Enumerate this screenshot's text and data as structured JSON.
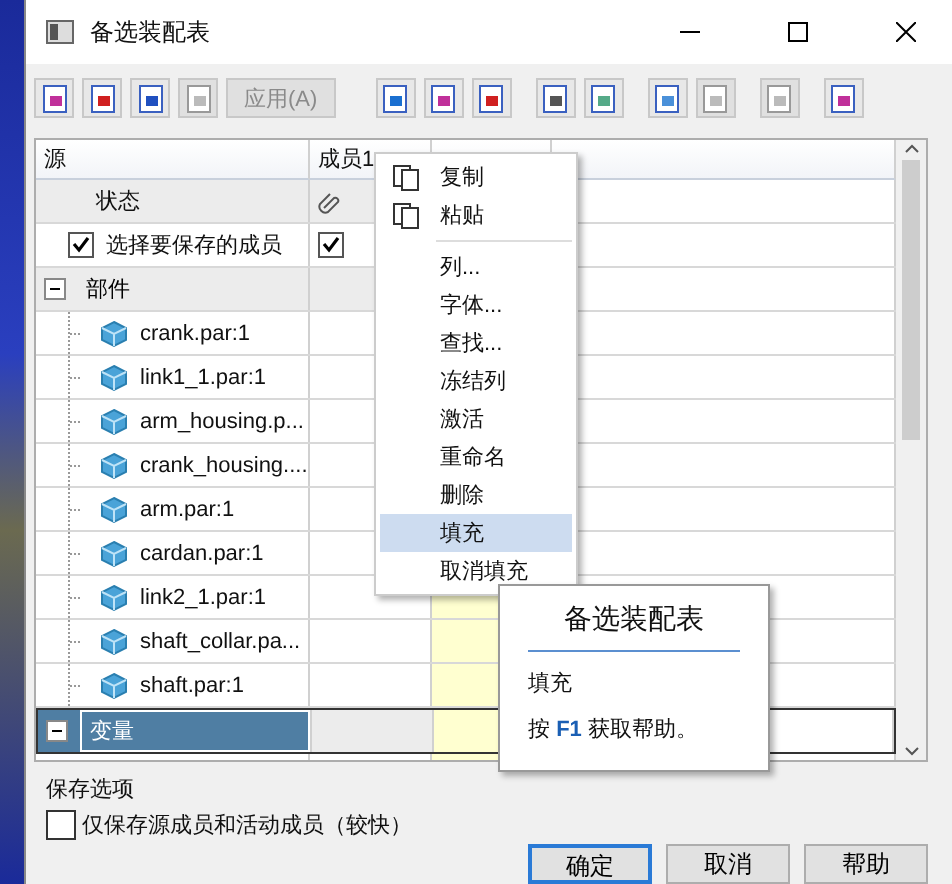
{
  "window": {
    "title": "备选装配表"
  },
  "toolbar": [
    {
      "kind": "icon",
      "disabled": false
    },
    {
      "kind": "icon",
      "disabled": false
    },
    {
      "kind": "icon",
      "disabled": false
    },
    {
      "kind": "icon",
      "disabled": true
    },
    {
      "kind": "text",
      "label": "应用(A)",
      "disabled": true
    },
    {
      "kind": "gap"
    },
    {
      "kind": "icon",
      "disabled": false
    },
    {
      "kind": "icon",
      "disabled": false
    },
    {
      "kind": "icon",
      "disabled": false
    },
    {
      "kind": "gap"
    },
    {
      "kind": "icon",
      "disabled": false
    },
    {
      "kind": "icon",
      "disabled": false
    },
    {
      "kind": "gap"
    },
    {
      "kind": "icon",
      "disabled": false
    },
    {
      "kind": "icon",
      "disabled": true
    },
    {
      "kind": "gap"
    },
    {
      "kind": "icon",
      "disabled": true
    },
    {
      "kind": "gap"
    },
    {
      "kind": "icon",
      "disabled": false
    }
  ],
  "table": {
    "columns": [
      {
        "label": "源"
      },
      {
        "label": "成员1"
      },
      {
        "filled": true
      }
    ],
    "rows": [
      {
        "kind": "status",
        "label": "状态"
      },
      {
        "kind": "check",
        "label": "选择要保存的成员",
        "checked": true,
        "member_checked": true
      },
      {
        "kind": "group",
        "label": "部件",
        "expanded": true,
        "selected": false,
        "children": [
          {
            "label": "crank.par:1"
          },
          {
            "label": "link1_1.par:1"
          },
          {
            "label": "arm_housing.p..."
          },
          {
            "label": "crank_housing...."
          },
          {
            "label": "arm.par:1"
          },
          {
            "label": "cardan.par:1"
          },
          {
            "label": "link2_1.par:1"
          },
          {
            "label": "shaft_collar.pa..."
          },
          {
            "label": "shaft.par:1"
          }
        ]
      },
      {
        "kind": "group",
        "label": "变量",
        "expanded": true,
        "selected": true
      }
    ]
  },
  "context_menu": [
    {
      "kind": "icon",
      "label": "复制",
      "selected": false
    },
    {
      "kind": "icon",
      "label": "粘贴",
      "selected": false
    },
    {
      "kind": "separator"
    },
    {
      "kind": "item",
      "label": "列...",
      "selected": false
    },
    {
      "kind": "item",
      "label": "字体...",
      "selected": false
    },
    {
      "kind": "item",
      "label": "查找...",
      "selected": false
    },
    {
      "kind": "item",
      "label": "冻结列",
      "selected": false
    },
    {
      "kind": "item",
      "label": "激活",
      "selected": false
    },
    {
      "kind": "item",
      "label": "重命名",
      "selected": false
    },
    {
      "kind": "item",
      "label": "删除",
      "selected": false
    },
    {
      "kind": "item",
      "label": "填充",
      "selected": true
    },
    {
      "kind": "item",
      "label": "取消填充",
      "selected": false
    }
  ],
  "tooltip": {
    "title": "备选装配表",
    "text": "填充",
    "help": "按 **F1** 获取帮助。"
  },
  "save_options": {
    "label": "保存选项",
    "checkbox": {
      "label": "仅保存源成员和活动成员（较快）",
      "checked": false
    }
  },
  "buttons": [
    {
      "label": "确定",
      "default": true
    },
    {
      "label": "取消",
      "default": false
    },
    {
      "label": "帮助",
      "default": false
    }
  ]
}
